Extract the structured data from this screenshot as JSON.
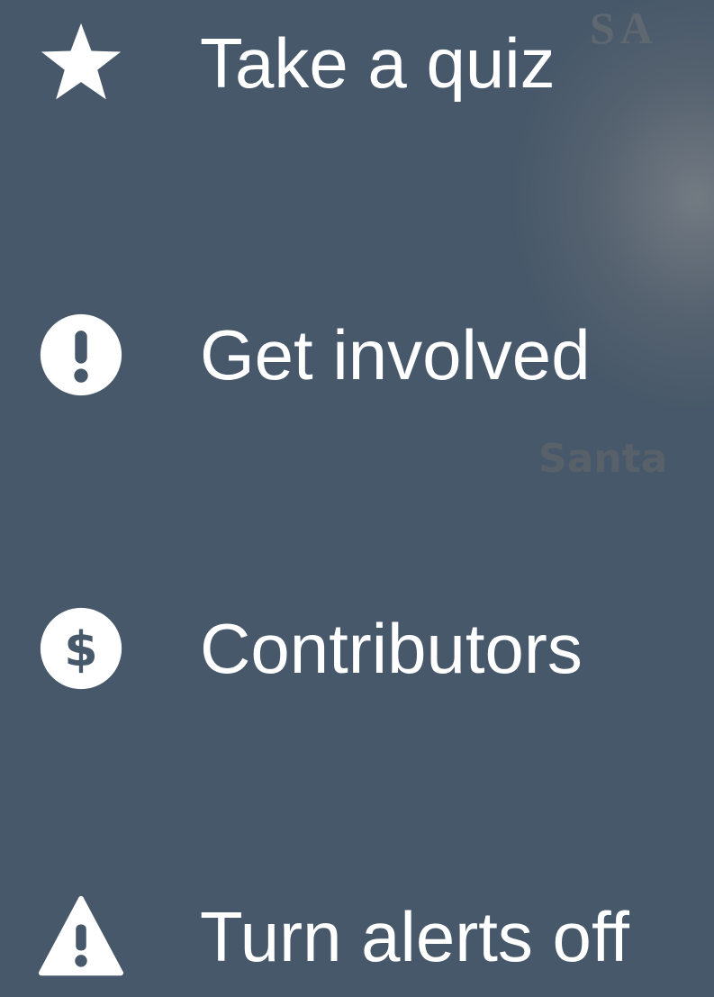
{
  "background_color": "#47586a",
  "map": {
    "top_label": "SA",
    "place_label": "Santa"
  },
  "menu": {
    "items": [
      {
        "label": "Take a quiz",
        "icon": "star-icon"
      },
      {
        "label": "Get involved",
        "icon": "exclamation-circle-icon"
      },
      {
        "label": "Contributors",
        "icon": "dollar-circle-icon"
      },
      {
        "label": "Turn alerts off",
        "icon": "warning-triangle-icon"
      }
    ]
  }
}
